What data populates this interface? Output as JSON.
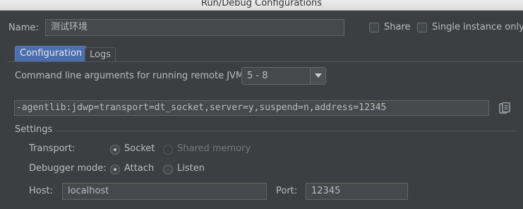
{
  "window": {
    "title": "Run/Debug Configurations"
  },
  "name_row": {
    "label": "Name:",
    "value": "测试环境",
    "share_label": "Share",
    "share_checked": false,
    "single_instance_label": "Single instance only",
    "single_instance_checked": false
  },
  "tabs": [
    {
      "label": "Configuration",
      "active": true
    },
    {
      "label": "Logs",
      "active": false
    }
  ],
  "jvm": {
    "label": "Command line arguments for running remote JVM",
    "selected": "5 - 8",
    "arguments": "-agentlib:jdwp=transport=dt_socket,server=y,suspend=n,address=12345"
  },
  "settings": {
    "heading": "Settings",
    "transport_label": "Transport:",
    "transport_options": [
      "Socket",
      "Shared memory"
    ],
    "transport_selected": "Socket",
    "debugger_mode_label": "Debugger mode:",
    "debugger_mode_options": [
      "Attach",
      "Listen"
    ],
    "debugger_mode_selected": "Attach",
    "host_label": "Host:",
    "host_value": "localhost",
    "port_label": "Port:",
    "port_value": "12345"
  },
  "icons": {
    "copy": "copy-icon",
    "dropdown": "chevron-down-icon"
  }
}
